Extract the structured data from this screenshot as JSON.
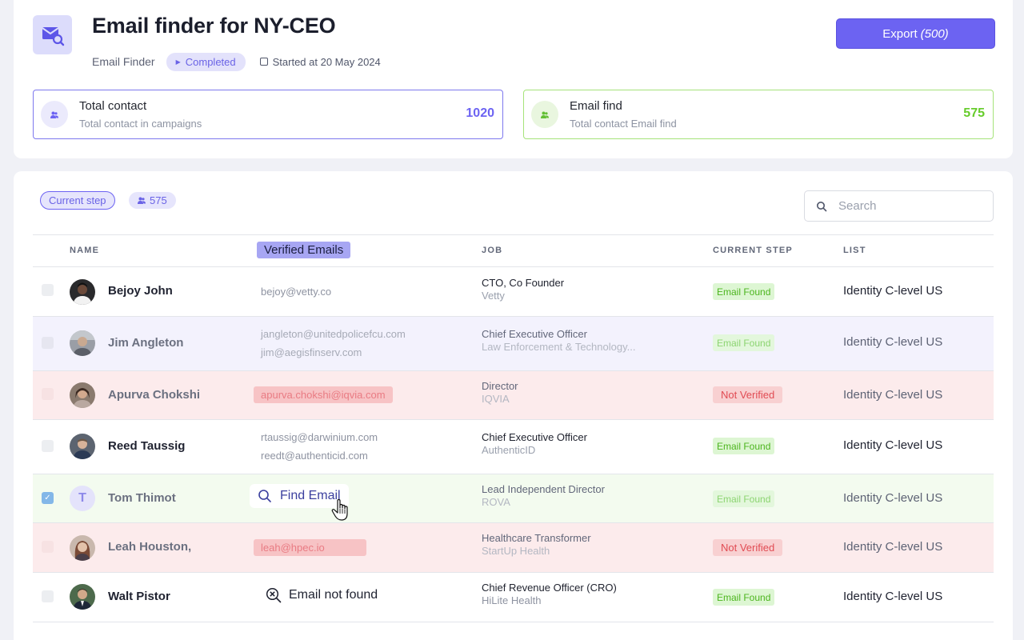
{
  "header": {
    "title": "Email finder for NY-CEO",
    "finder_label": "Email Finder",
    "status": "Completed",
    "started": "Started at 20 May 2024",
    "export_label": "Export",
    "export_count": "(500)"
  },
  "stats": {
    "total": {
      "title": "Total contact",
      "subtitle": "Total contact in campaigns",
      "value": "1020"
    },
    "email": {
      "title": "Email find",
      "subtitle": "Total contact Email find",
      "value": "575"
    }
  },
  "toolbar": {
    "step_label": "Current step",
    "count": "575",
    "search_placeholder": "Search"
  },
  "table": {
    "headers": {
      "name": "NAME",
      "emails": "Verified Emails",
      "job": "JOB",
      "step": "CURRENT STEP",
      "list": "LIST"
    },
    "rows": [
      {
        "name": "Bejoy John",
        "emails": [
          "bejoy@vetty.co"
        ],
        "job_title": "CTO, Co Founder",
        "company": "Vetty",
        "step": "Email Found",
        "list": "Identity C-level US"
      },
      {
        "name": "Jim Angleton",
        "emails": [
          "jangleton@unitedpolicefcu.com",
          "jim@aegisfinserv.com"
        ],
        "job_title": "Chief Executive Officer",
        "company": "Law Enforcement & Technology...",
        "step": "Email Found",
        "list": "Identity C-level US"
      },
      {
        "name": "Apurva Chokshi",
        "emails": [
          "apurva.chokshi@iqvia.com"
        ],
        "job_title": "Director",
        "company": "IQVIA",
        "step": "Not Verified",
        "list": "Identity C-level US"
      },
      {
        "name": "Reed Taussig",
        "emails": [
          "rtaussig@darwinium.com",
          "reedt@authenticid.com"
        ],
        "job_title": "Chief Executive Officer",
        "company": "AuthenticID",
        "step": "Email Found",
        "list": "Identity C-level US"
      },
      {
        "name": "Tom Thimot",
        "avatar_letter": "T",
        "find_email": "Find Email",
        "job_title": "Lead Independent Director",
        "company": "ROVA",
        "step": "Email Found",
        "list": "Identity C-level US"
      },
      {
        "name": "Leah Houston,",
        "emails": [
          "leah@hpec.io"
        ],
        "job_title": "Healthcare Transformer",
        "company": "StartUp Health",
        "step": "Not Verified",
        "list": "Identity C-level US"
      },
      {
        "name": "Walt Pistor",
        "not_found": "Email not found",
        "job_title": "Chief Revenue Officer (CRO)",
        "company": "HiLite Health",
        "step": "Email Found",
        "list": "Identity C-level US"
      }
    ]
  }
}
